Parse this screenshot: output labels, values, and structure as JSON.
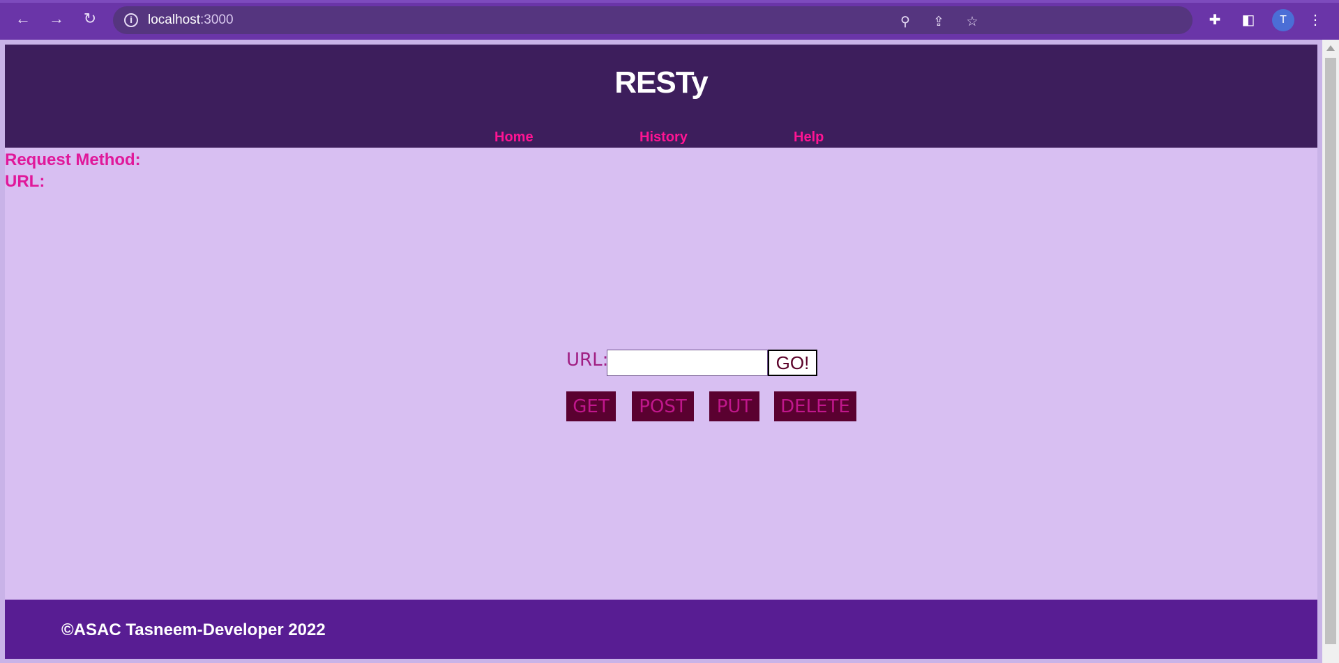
{
  "browser": {
    "url_host": "localhost",
    "url_port": ":3000",
    "avatar_initial": "T",
    "icons": [
      "back-arrow-icon",
      "forward-arrow-icon",
      "reload-icon",
      "info-icon",
      "zoom-out-icon",
      "share-icon",
      "star-icon",
      "extensions-icon",
      "side-panel-icon",
      "menu-icon"
    ]
  },
  "header": {
    "title": "RESTy",
    "nav": [
      "Home",
      "History",
      "Help"
    ]
  },
  "results": {
    "method_label": "Request Method:",
    "url_label": "URL:"
  },
  "form": {
    "url_label": "URL:",
    "url_value": "",
    "go_label": "GO!",
    "methods": [
      "GET",
      "POST",
      "PUT",
      "DELETE"
    ]
  },
  "footer": {
    "copyright": "©ASAC Tasneem-Developer 2022"
  },
  "colors": {
    "header_bg": "#3d1e5c",
    "page_bg": "#d8bff2",
    "accent_pink": "#e0189a",
    "method_btn_bg": "#5a0130",
    "footer_bg": "#581d93"
  }
}
